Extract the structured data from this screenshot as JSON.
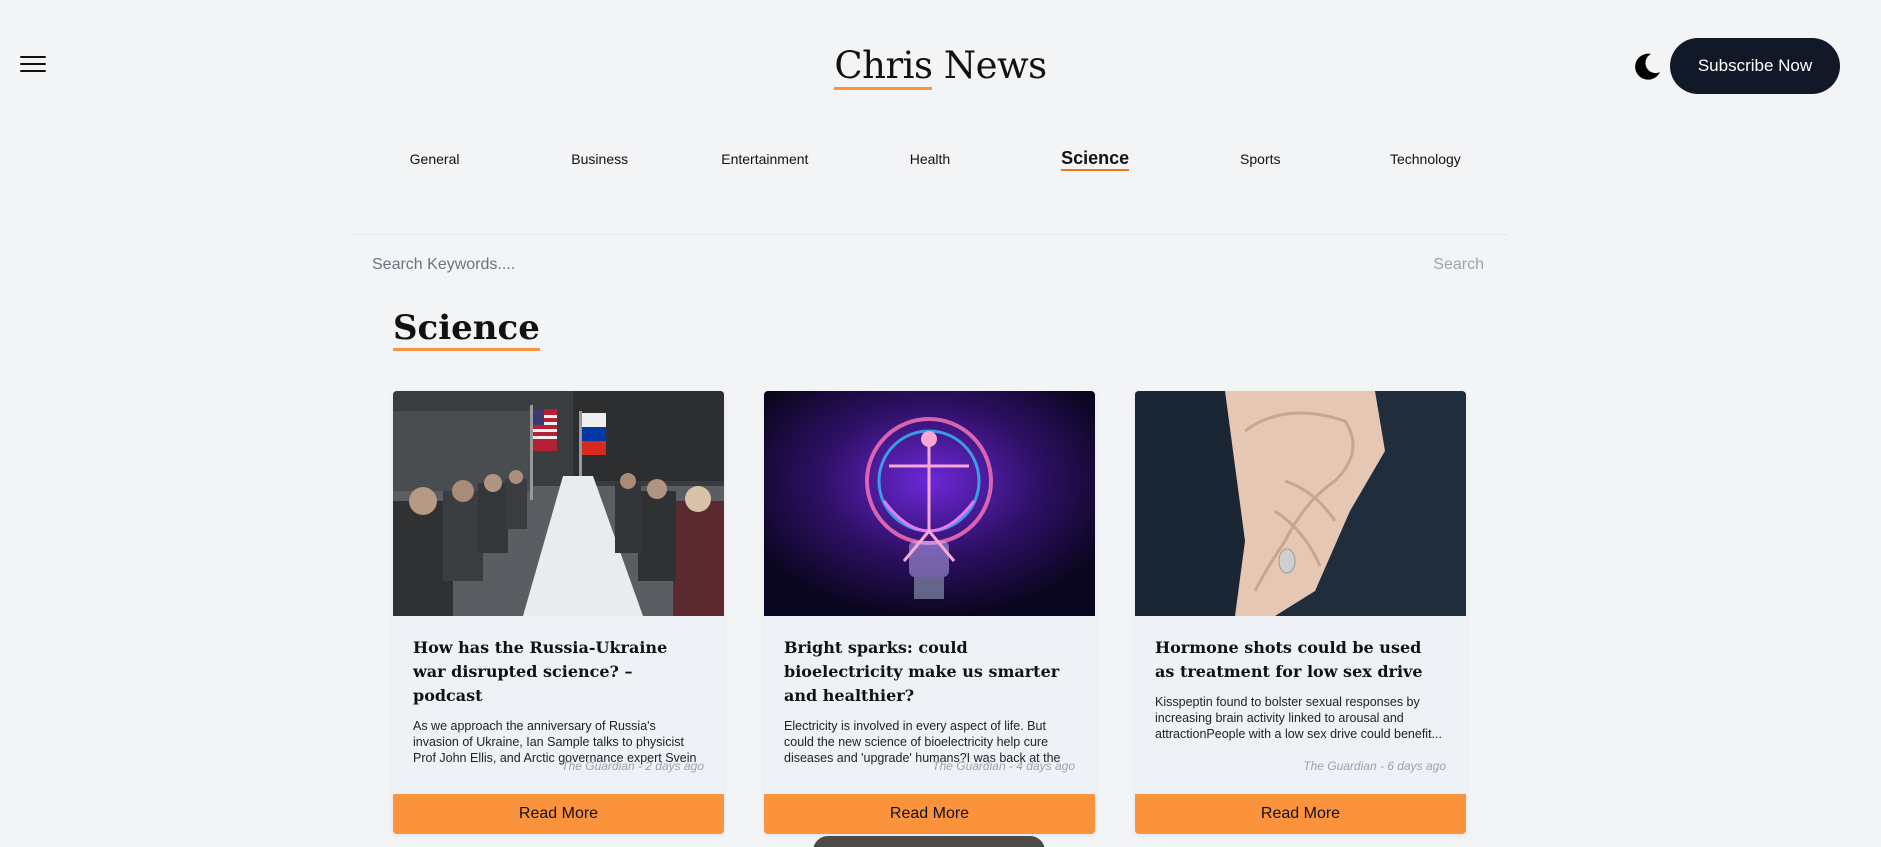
{
  "header": {
    "brand_first": "Chris",
    "brand_second": "News",
    "subscribe_label": "Subscribe Now",
    "menu_icon": "hamburger-icon",
    "theme_icon": "moon-icon"
  },
  "nav": {
    "items": [
      {
        "label": "General"
      },
      {
        "label": "Business"
      },
      {
        "label": "Entertainment"
      },
      {
        "label": "Health"
      },
      {
        "label": "Science",
        "active": true
      },
      {
        "label": "Sports"
      },
      {
        "label": "Technology"
      }
    ]
  },
  "search": {
    "placeholder": "Search Keywords....",
    "button_label": "Search"
  },
  "section": {
    "title": "Science"
  },
  "articles": [
    {
      "title": "How has the Russia-Ukraine war disrupted science? – podcast",
      "summary": "As we approach the anniversary of Russia's invasion of Ukraine, Ian Sample talks to physicist Prof John Ellis, and Arctic governance expert Svein Vigeland Rottem,...",
      "meta": "The Guardian - 2 days ago",
      "button": "Read More"
    },
    {
      "title": "Bright sparks: could bioelectricity make us smarter and healthier?",
      "summary": "Electricity is involved in every aspect of life. But could the new science of bioelectricity help cure diseases and 'upgrade' humans?I was back at the checkpoint....",
      "meta": "The Guardian - 4 days ago",
      "button": "Read More"
    },
    {
      "title": "Hormone shots could be used as treatment for low sex drive",
      "summary": "Kisspeptin found to bolster sexual responses by increasing brain activity linked to arousal and attractionPeople with a low sex drive could benefit...",
      "meta": "The Guardian - 6 days ago",
      "button": "Read More"
    }
  ],
  "colors": {
    "accent": "#fb923c",
    "dark": "#111827",
    "background": "#f3f4f6"
  }
}
